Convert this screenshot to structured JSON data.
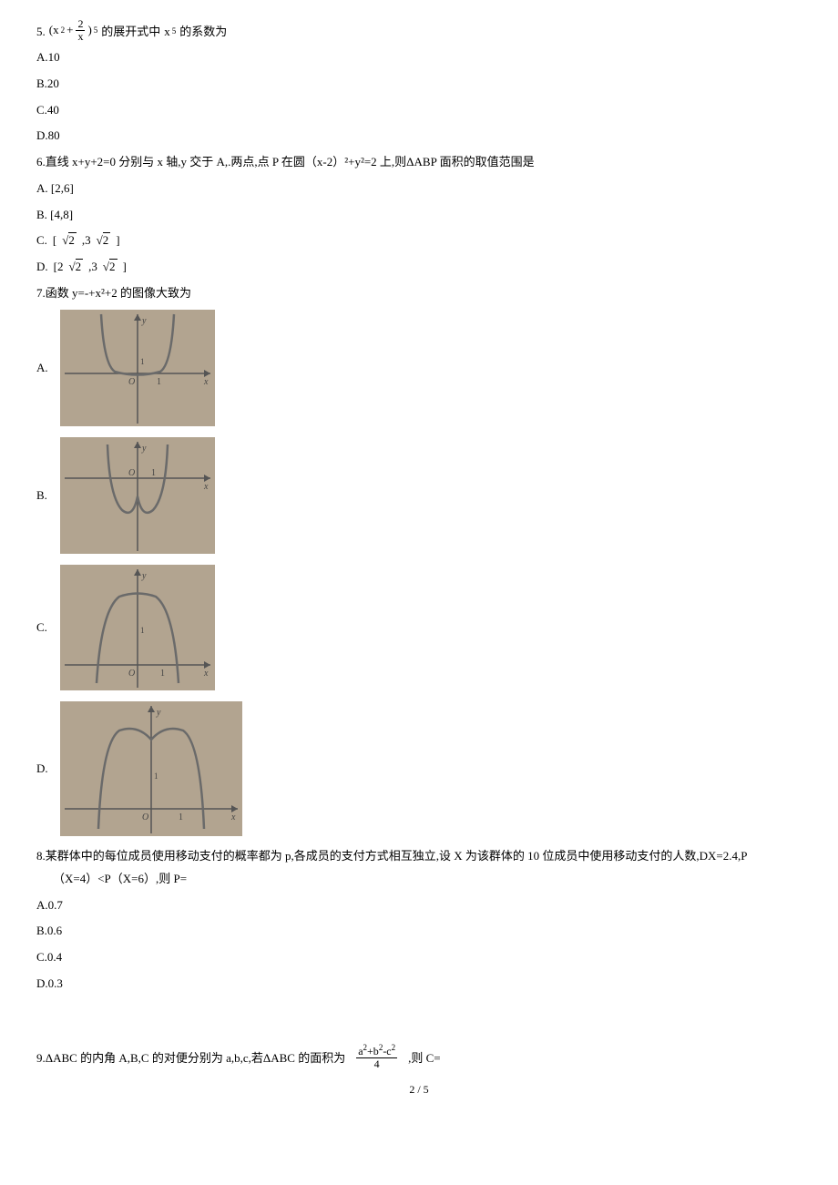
{
  "q5": {
    "num": "5.",
    "expr_left": "(x",
    "expr_sup2a": "2",
    "expr_plus": "+",
    "frac_num": "2",
    "frac_den": "x",
    "expr_paren": ")",
    "expr_power5": "5",
    "text_mid": "的展开式中",
    "x_var": "x",
    "x_pow": "5",
    "text_end": "的系数为",
    "a": "A.10",
    "b": "B.20",
    "c": "C.40",
    "d": "D.80"
  },
  "q6": {
    "text": "6.直线 x+y+2=0 分别与 x 轴,y 交于 A,.两点,点 P 在圆（x-2）²+y²=2 上,则ΔABP 面积的取值范围是",
    "a": "A. [2,6]",
    "b": "B. [4,8]",
    "c_prefix": "C. ",
    "c_lb": "[",
    "c_v1": "2",
    "c_comma": ",3",
    "c_v2": "2",
    "c_rb": "]",
    "d_prefix": "D. ",
    "d_lb": "[2",
    "d_v1": "2",
    "d_comma": ",3",
    "d_v2": "2",
    "d_rb": "]"
  },
  "q7": {
    "text": "7.函数 y=-+x²+2 的图像大致为",
    "a": "A.",
    "b": "B.",
    "c": "C.",
    "d": "D."
  },
  "q8": {
    "line1": "8.某群体中的每位成员使用移动支付的概率都为 p,各成员的支付方式相互独立,设 X 为该群体的 10 位成员中使用移动支付的人数,DX=2.4,P",
    "line2": "（X=4）<P（X=6）,则 P=",
    "a": "A.0.7",
    "b": "B.0.6",
    "c": "C.0.4",
    "d": "D.0.3"
  },
  "q9": {
    "part1": "9.ΔABC 的内角 A,B,C 的对便分别为 a,b,c,若ΔABC 的面积为",
    "frac_num_a": "a",
    "frac_num_p2a": "2",
    "frac_num_plus1": "+b",
    "frac_num_p2b": "2",
    "frac_num_minus": "-c",
    "frac_num_p2c": "2",
    "frac_den": "4",
    "part2": ",则 C="
  },
  "page": "2 / 5"
}
